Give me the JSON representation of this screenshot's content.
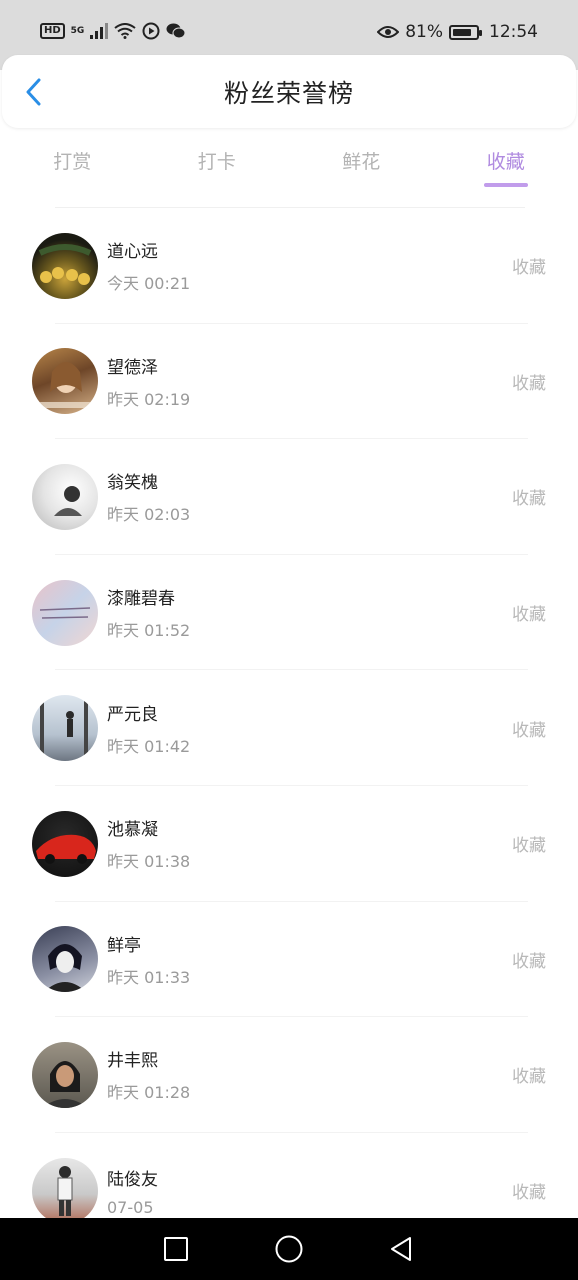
{
  "status_bar": {
    "hd": "HD",
    "signal": "5G",
    "battery_percent": "81%",
    "battery_level": 0.81,
    "time": "12:54"
  },
  "header": {
    "title": "粉丝荣誉榜",
    "back_icon": "chevron-left-icon",
    "accent": "#2a8ee6"
  },
  "tabs": [
    {
      "label": "打赏",
      "active": false
    },
    {
      "label": "打卡",
      "active": false
    },
    {
      "label": "鲜花",
      "active": false
    },
    {
      "label": "收藏",
      "active": true
    }
  ],
  "accent_color": "#b08be0",
  "fans": [
    {
      "name": "道心远",
      "time": "今天 00:21",
      "action": "收藏"
    },
    {
      "name": "望德泽",
      "time": "昨天 02:19",
      "action": "收藏"
    },
    {
      "name": "翁笑槐",
      "time": "昨天 02:03",
      "action": "收藏"
    },
    {
      "name": "漆雕碧春",
      "time": "昨天 01:52",
      "action": "收藏"
    },
    {
      "name": "严元良",
      "time": "昨天 01:42",
      "action": "收藏"
    },
    {
      "name": "池慕凝",
      "time": "昨天 01:38",
      "action": "收藏"
    },
    {
      "name": "鲜亭",
      "time": "昨天 01:33",
      "action": "收藏"
    },
    {
      "name": "井丰熙",
      "time": "昨天 01:28",
      "action": "收藏"
    },
    {
      "name": "陆俊友",
      "time": "07-05",
      "action": "收藏"
    }
  ],
  "nav_bar": {
    "recent_icon": "square-icon",
    "home_icon": "circle-icon",
    "back_icon": "triangle-back-icon"
  }
}
